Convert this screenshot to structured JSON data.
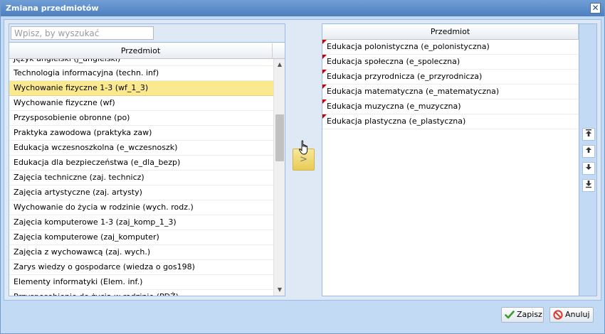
{
  "window": {
    "title": "Zmiana przedmiotów",
    "close_symbol": "✕"
  },
  "search": {
    "placeholder": "Wpisz, by wyszukać",
    "value": ""
  },
  "left_list": {
    "header": "Przedmiot",
    "partial_item": "Język angielski (j_angielski)",
    "items": [
      {
        "label": "Technologia informacyjna (techn. inf)",
        "selected": false
      },
      {
        "label": "Wychowanie fizyczne 1-3 (wf_1_3)",
        "selected": true
      },
      {
        "label": "Wychowanie fizyczne (wf)",
        "selected": false
      },
      {
        "label": "Przysposobienie obronne (po)",
        "selected": false
      },
      {
        "label": "Praktyka zawodowa (praktyka zaw)",
        "selected": false
      },
      {
        "label": "Edukacja wczesnoszkolna (e_wczesnoszk)",
        "selected": false
      },
      {
        "label": "Edukacja dla bezpieczeństwa (e_dla_bezp)",
        "selected": false
      },
      {
        "label": "Zajęcia techniczne (zaj. technicz)",
        "selected": false
      },
      {
        "label": "Zajęcia artystyczne (zaj. artysty)",
        "selected": false
      },
      {
        "label": "Wychowanie do życia w rodzinie (wych. rodz.)",
        "selected": false
      },
      {
        "label": "Zajęcia komputerowe 1-3 (zaj_komp_1_3)",
        "selected": false
      },
      {
        "label": "Zajęcia komputerowe (zaj_komputer)",
        "selected": false
      },
      {
        "label": "Zajęcia z wychowawcą (zaj. wych.)",
        "selected": false
      },
      {
        "label": "Zarys wiedzy o gospodarce (wiedza o gos198)",
        "selected": false
      },
      {
        "label": "Elementy informatyki (Elem. inf.)",
        "selected": false
      },
      {
        "label": "Przysposobienie do życia w rodzinie (PDŻ)",
        "selected": false
      }
    ]
  },
  "move_button": {
    "label": ">"
  },
  "right_list": {
    "header": "Przedmiot",
    "items": [
      {
        "label": "Edukacja polonistyczna (e_polonistyczna)"
      },
      {
        "label": "Edukacja społeczna (e_spoleczna)"
      },
      {
        "label": "Edukacja przyrodnicza (e_przyrodnicza)"
      },
      {
        "label": "Edukacja matematyczna (e_matematyczna)"
      },
      {
        "label": "Edukacja muzyczna (e_muzyczna)"
      },
      {
        "label": "Edukacja plastyczna (e_plastyczna)"
      }
    ]
  },
  "order_tools": {
    "icons": [
      "move-top-icon",
      "move-up-icon",
      "move-down-icon",
      "move-bottom-icon"
    ]
  },
  "footer": {
    "save_label": "Zapisz",
    "cancel_label": "Anuluj"
  },
  "colors": {
    "selected_row": "#fbe98f",
    "titlebar": "#5b8dcc",
    "dirty_marker": "#cc0000",
    "save_check": "#3c9a2f",
    "cancel_icon": "#d9392b"
  }
}
